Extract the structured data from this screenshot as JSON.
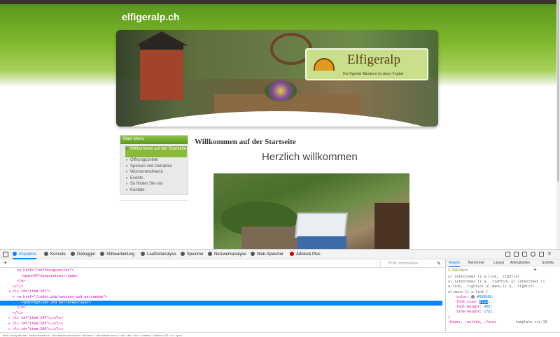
{
  "site": {
    "title": "elfigeralp.ch"
  },
  "logo": {
    "brand": "Elfigeralp",
    "tagline": "Die Ogenfer Bänderei im obern Frutttal"
  },
  "menu": {
    "heading": "Main Menu",
    "items": [
      "Willkommen auf der Startseite",
      "Öffnungszeiten",
      "Speisen und Getränke",
      "Wochenendmenü",
      "Events",
      "So finden Sie uns",
      "Kontakt"
    ]
  },
  "content": {
    "heading": "Willkommen auf der Startseite",
    "subheading": "Herzlich willkommen"
  },
  "devtools": {
    "tabs": [
      "Inspektor",
      "Konsole",
      "Debugger",
      "Stilbearbeitung",
      "Laufzeitanalyse",
      "Speicher",
      "Netzwerkanalyse",
      "Web-Speicher",
      "Adblock Plus"
    ],
    "active_tab": "Inspektor",
    "search_placeholder": "HTML durchsuchen",
    "markup_lines": [
      "        <a href=\"/oeffnungszeiten\">",
      "          <span>Öffnungszeiten</span>",
      "        </a>",
      "      </li>",
      "    ▾ <li id=\"item-103\">",
      "      ▾ <a href=\"/index.php/speisen-und-getraenke\">",
      "          <span>Speisen und Getränke</span>",
      "        </a>",
      "      </li>",
      "    ▸ <li id=\"item-104\">…</li>",
      "    ▸ <li id=\"item-105\">…</li>",
      "    ▸ <li id=\"item-108\">…</li>"
    ],
    "selected_line": 6,
    "rules_tabs": [
      "Regeln",
      "Berechnet",
      "Layout",
      "Animationen",
      "Schrifta"
    ],
    "filter_placeholder": "Stile filtern",
    "rules_selectors": [
      "ul.latestnews li a:link, .rightcol",
      "ul.latestnews li a, .rightcol ul.latestnews li",
      "a:link, .rightcol ul.menu li a, .rightcol",
      "ul.menu li a:link {"
    ],
    "color_decl": {
      "prop": "color:",
      "value": "#888888;"
    },
    "font_size_decl": {
      "prop": "font-size:",
      "value": "11px"
    },
    "font_weight_decl": {
      "prop": "font-weight:",
      "value": "400;"
    },
    "line_height_decl": {
      "prop": "line-height:",
      "value": "17px;"
    },
    "rule_close": "}",
    "pseudo_line": ":hover, :active, :focus",
    "rule_source": "template.css:19",
    "breadcrumbs": "html > body.site.ha > section#content > div.module-outer.a.left > div.inner > div.module-menu > div > div > div > ul.menu > li#item-103 > a > span"
  }
}
